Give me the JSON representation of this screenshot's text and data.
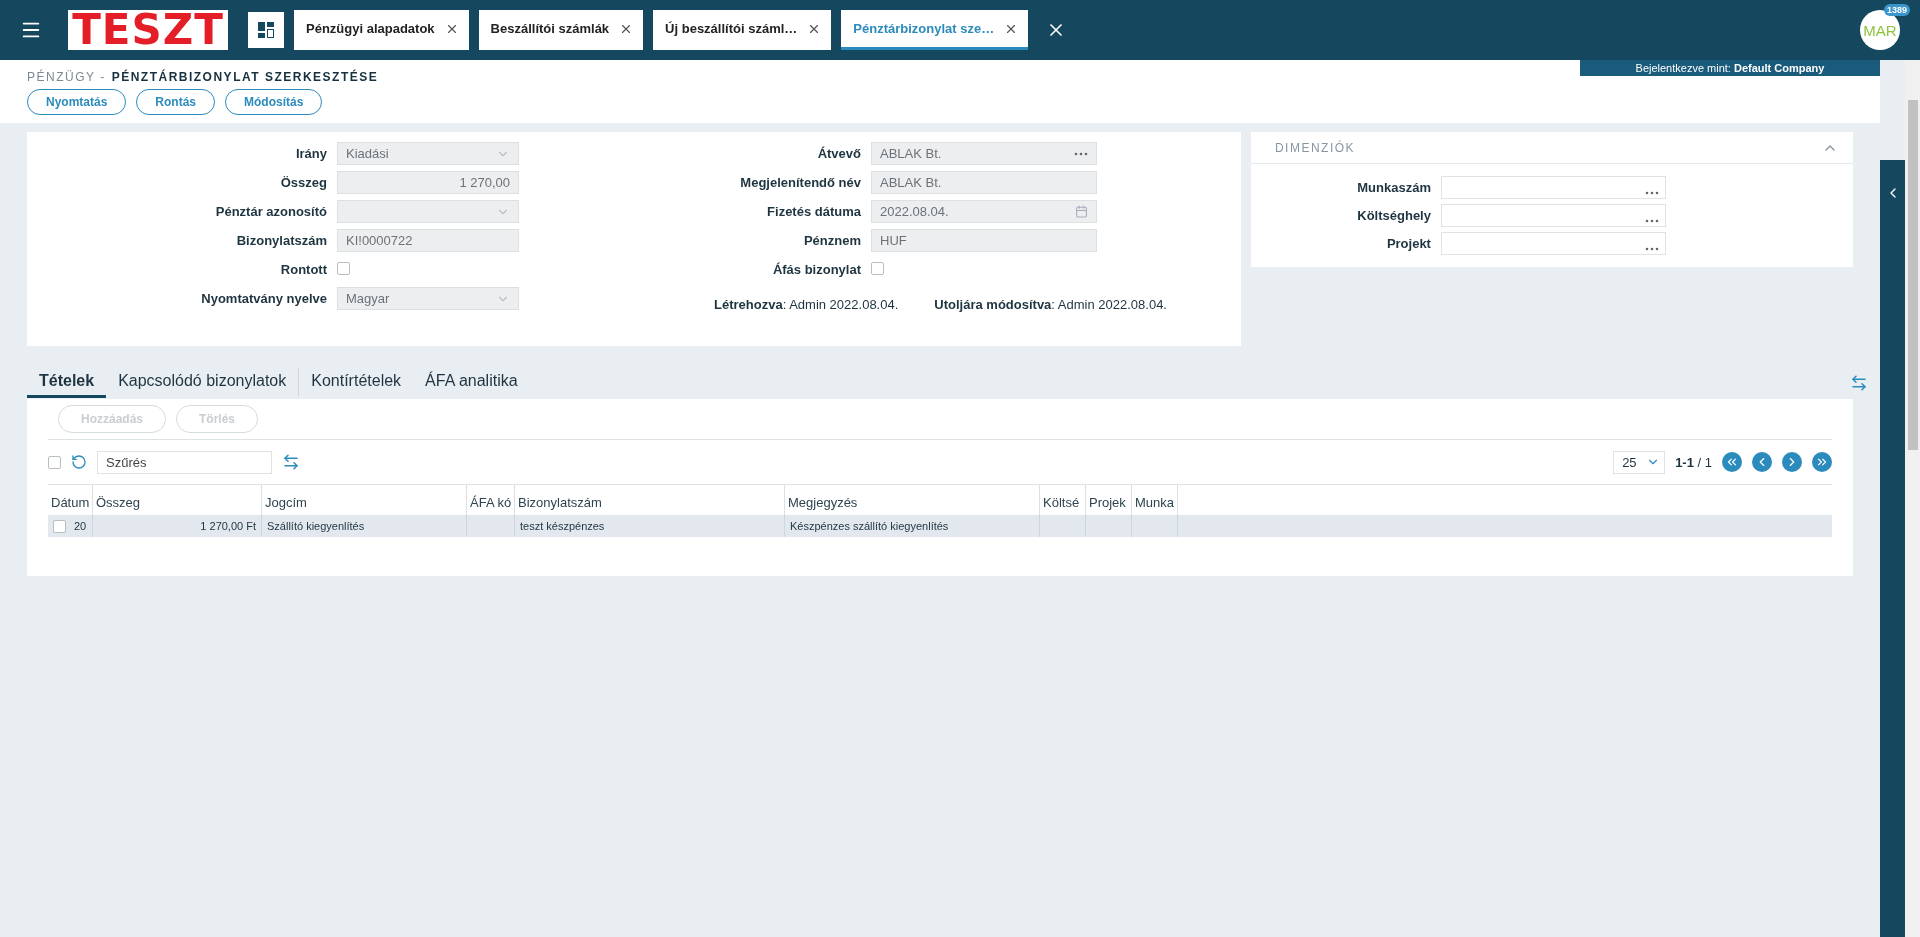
{
  "topbar": {
    "logo": "TESZT",
    "tabs": [
      {
        "label": "Pénzügyi alapadatok",
        "selected": false
      },
      {
        "label": "Beszállítói számlák",
        "selected": false
      },
      {
        "label": "Új beszállítói száml…",
        "selected": false
      },
      {
        "label": "Pénztárbizonylat sze…",
        "selected": true
      }
    ],
    "avatar": "MAR",
    "badge": "1389"
  },
  "login": "Bejelentkezve mint: **Default Company**",
  "breadcrumb": {
    "parent": "PÉNZÜGY -",
    "title": "PÉNZTÁRBIZONYLAT SZERKESZTÉSE"
  },
  "actions": [
    "Nyomtatás",
    "Rontás",
    "Módosítás"
  ],
  "form": {
    "left": [
      {
        "label": "Irány",
        "kind": "select",
        "value": "Kiadási"
      },
      {
        "label": "Összeg",
        "kind": "amount",
        "value": "1 270,00"
      },
      {
        "label": "Pénztár azonosító",
        "kind": "select"
      },
      {
        "label": "Bizonylatszám",
        "kind": "text",
        "value": "KI!0000722"
      },
      {
        "label": "Rontott",
        "kind": "checkbox",
        "checked": false
      },
      {
        "label": "Nyomtatvány nyelve",
        "kind": "select",
        "value": "Magyar"
      }
    ],
    "right": [
      {
        "label": "Átvevő",
        "kind": "lookup",
        "value": "ABLAK Bt."
      },
      {
        "label": "Megjelenítendő név",
        "kind": "text",
        "value": "ABLAK Bt."
      },
      {
        "label": "Fizetés dátuma",
        "kind": "date",
        "value": "2022.08.04."
      },
      {
        "label": "Pénznem",
        "kind": "text",
        "value": "HUF"
      },
      {
        "label": "Áfás bizonylat",
        "kind": "checkbox",
        "checked": false
      }
    ],
    "created": "**Létrehozva**: Admin 2022.08.04.",
    "modified": "**Utoljára módosítva**: Admin 2022.08.04."
  },
  "dimensions": {
    "title": "DIMENZIÓK",
    "expanded": true,
    "fields": [
      {
        "label": "Munkaszám"
      },
      {
        "label": "Költséghely"
      },
      {
        "label": "Projekt"
      }
    ]
  },
  "section_tabs": [
    {
      "label": "Tételek",
      "selected": true
    },
    {
      "label": "Kapcsolódó bizonylatok",
      "selected": false
    },
    {
      "label": "Kontírtételek",
      "selected": false
    },
    {
      "label": "ÁFA analitika",
      "selected": false
    }
  ],
  "items": {
    "buttons": [
      {
        "label": "Hozzáadás",
        "disabled": true
      },
      {
        "label": "Törlés",
        "disabled": true
      }
    ],
    "select_all_checked": false,
    "filter_placeholder": "Szűrés",
    "page_size": "25",
    "pagination": "**1-1** / 1",
    "columns": [
      "Dátum",
      "Összeg",
      "Jogcím",
      "ÁFA kó",
      "Bizonylatszám",
      "Megjegyzés",
      "Költsé",
      "Projek",
      "Munka"
    ],
    "rows": [
      {
        "checked": false,
        "cells": [
          {
            "text": "20",
            "kind": "text"
          },
          {
            "text": "1 270,00 Ft",
            "kind": "amount"
          },
          {
            "text": "Szállító kiegyenlítés",
            "kind": "text"
          },
          {},
          {
            "text": "teszt készpénzes",
            "kind": "text"
          },
          {
            "text": "Készpénzes szállító kiegyenlítés",
            "kind": "text"
          },
          {},
          {},
          {}
        ]
      }
    ]
  }
}
